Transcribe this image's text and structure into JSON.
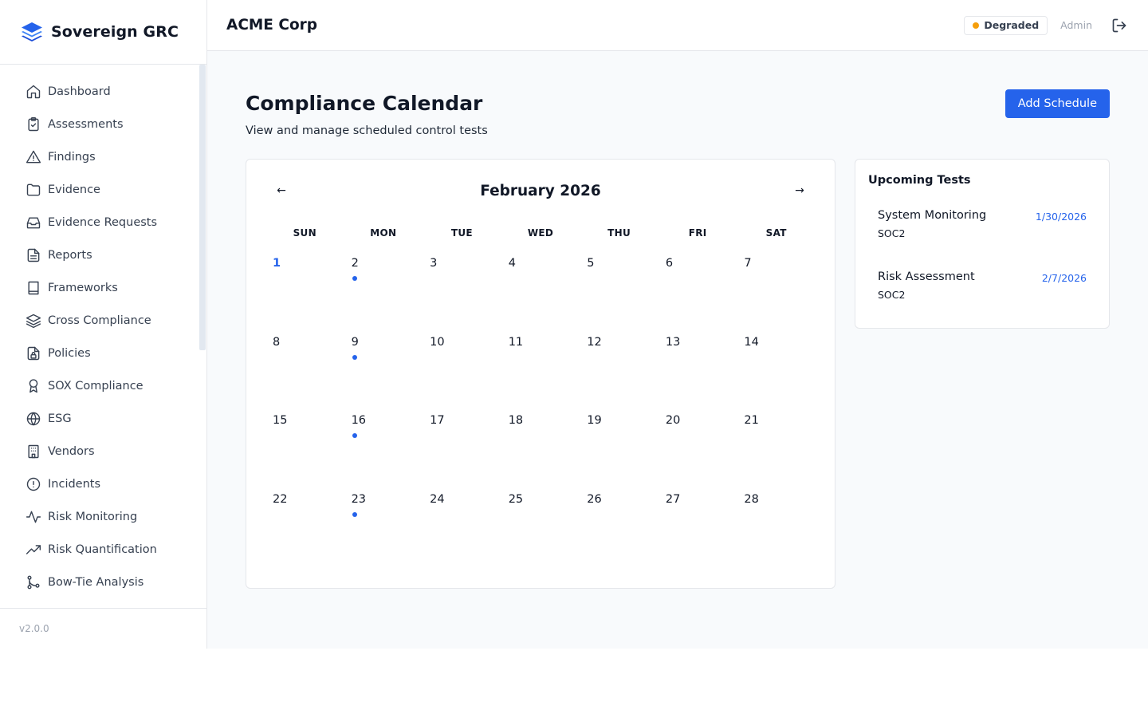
{
  "brand": {
    "name": "Sovereign GRC"
  },
  "sidebar": {
    "items": [
      {
        "label": "Dashboard",
        "icon": "home-icon"
      },
      {
        "label": "Assessments",
        "icon": "clipboard-check-icon"
      },
      {
        "label": "Findings",
        "icon": "alert-triangle-icon"
      },
      {
        "label": "Evidence",
        "icon": "folder-icon"
      },
      {
        "label": "Evidence Requests",
        "icon": "inbox-icon"
      },
      {
        "label": "Reports",
        "icon": "file-text-icon"
      },
      {
        "label": "Frameworks",
        "icon": "book-icon"
      },
      {
        "label": "Cross Compliance",
        "icon": "layers-icon"
      },
      {
        "label": "Policies",
        "icon": "file-lock-icon"
      },
      {
        "label": "SOX Compliance",
        "icon": "award-icon"
      },
      {
        "label": "ESG",
        "icon": "globe-icon"
      },
      {
        "label": "Vendors",
        "icon": "building-icon"
      },
      {
        "label": "Incidents",
        "icon": "alert-circle-icon"
      },
      {
        "label": "Risk Monitoring",
        "icon": "activity-icon"
      },
      {
        "label": "Risk Quantification",
        "icon": "trending-up-icon"
      },
      {
        "label": "Bow-Tie Analysis",
        "icon": "git-branch-icon"
      }
    ],
    "version": "v2.0.0"
  },
  "topbar": {
    "org_name": "ACME Corp",
    "status": {
      "label": "Degraded",
      "color": "#f59e0b"
    },
    "user_role": "Admin",
    "logout_icon": "logout-icon"
  },
  "page": {
    "title": "Compliance Calendar",
    "subtitle": "View and manage scheduled control tests",
    "add_button": "Add Schedule"
  },
  "calendar": {
    "month_label": "February 2026",
    "prev_label": "←",
    "next_label": "→",
    "weekdays": [
      "SUN",
      "MON",
      "TUE",
      "WED",
      "THU",
      "FRI",
      "SAT"
    ],
    "days": [
      {
        "num": "1",
        "today": true,
        "event": false
      },
      {
        "num": "2",
        "today": false,
        "event": true
      },
      {
        "num": "3",
        "today": false,
        "event": false
      },
      {
        "num": "4",
        "today": false,
        "event": false
      },
      {
        "num": "5",
        "today": false,
        "event": false
      },
      {
        "num": "6",
        "today": false,
        "event": false
      },
      {
        "num": "7",
        "today": false,
        "event": false
      },
      {
        "num": "8",
        "today": false,
        "event": false
      },
      {
        "num": "9",
        "today": false,
        "event": true
      },
      {
        "num": "10",
        "today": false,
        "event": false
      },
      {
        "num": "11",
        "today": false,
        "event": false
      },
      {
        "num": "12",
        "today": false,
        "event": false
      },
      {
        "num": "13",
        "today": false,
        "event": false
      },
      {
        "num": "14",
        "today": false,
        "event": false
      },
      {
        "num": "15",
        "today": false,
        "event": false
      },
      {
        "num": "16",
        "today": false,
        "event": true
      },
      {
        "num": "17",
        "today": false,
        "event": false
      },
      {
        "num": "18",
        "today": false,
        "event": false
      },
      {
        "num": "19",
        "today": false,
        "event": false
      },
      {
        "num": "20",
        "today": false,
        "event": false
      },
      {
        "num": "21",
        "today": false,
        "event": false
      },
      {
        "num": "22",
        "today": false,
        "event": false
      },
      {
        "num": "23",
        "today": false,
        "event": true
      },
      {
        "num": "24",
        "today": false,
        "event": false
      },
      {
        "num": "25",
        "today": false,
        "event": false
      },
      {
        "num": "26",
        "today": false,
        "event": false
      },
      {
        "num": "27",
        "today": false,
        "event": false
      },
      {
        "num": "28",
        "today": false,
        "event": false
      }
    ]
  },
  "upcoming": {
    "title": "Upcoming Tests",
    "tests": [
      {
        "name": "System Monitoring",
        "framework": "SOC2",
        "date": "1/30/2026"
      },
      {
        "name": "Risk Assessment",
        "framework": "SOC2",
        "date": "2/7/2026"
      }
    ]
  },
  "colors": {
    "accent": "#2563eb",
    "status_degraded": "#f59e0b"
  }
}
